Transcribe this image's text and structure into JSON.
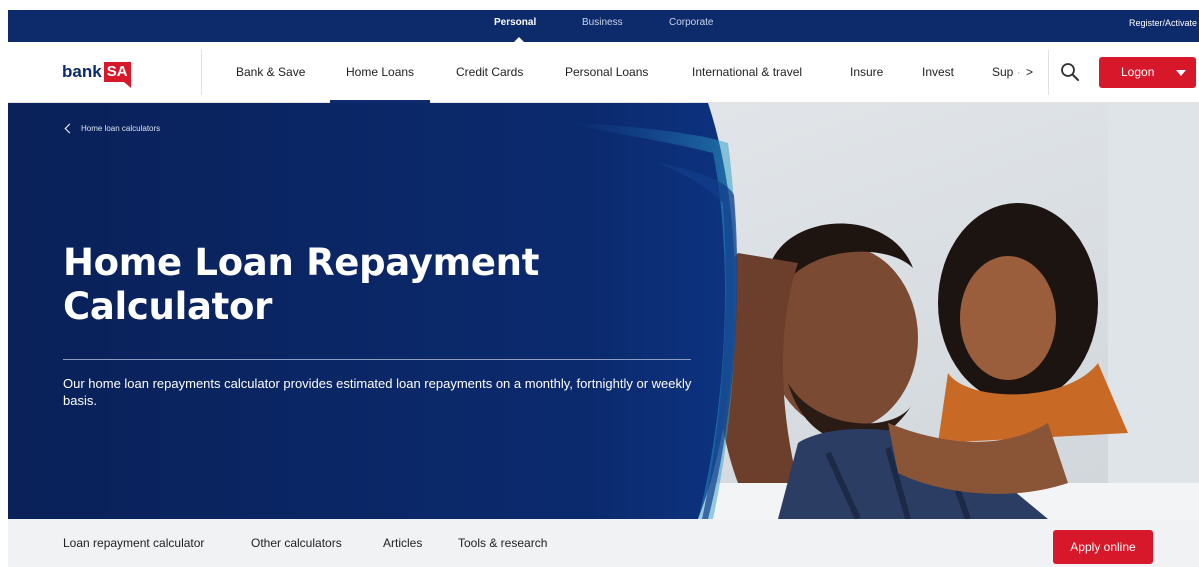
{
  "segments": {
    "items": [
      {
        "label": "Personal",
        "active": true
      },
      {
        "label": "Business",
        "active": false
      },
      {
        "label": "Corporate",
        "active": false
      }
    ],
    "register_label": "Register/Activate"
  },
  "brand": {
    "logo_text": "bank",
    "logo_badge": "SA",
    "accent": "#d6182a",
    "navy": "#0d2a6b"
  },
  "nav": {
    "items": [
      {
        "label": "Bank & Save"
      },
      {
        "label": "Home Loans",
        "active": true
      },
      {
        "label": "Credit Cards"
      },
      {
        "label": "Personal Loans"
      },
      {
        "label": "International & travel"
      },
      {
        "label": "Insure"
      },
      {
        "label": "Invest"
      }
    ],
    "truncated_label": "Sup",
    "more_glyph": ">",
    "search_icon": "search-icon",
    "logon_label": "Logon"
  },
  "hero": {
    "breadcrumb": "Home loan calculators",
    "title": "Home Loan Repayment Calculator",
    "description": "Our home loan repayments calculator provides estimated loan repayments on a monthly, fortnightly or weekly basis."
  },
  "subnav": {
    "items": [
      {
        "label": "Loan repayment calculator"
      },
      {
        "label": "Other calculators"
      },
      {
        "label": "Articles"
      },
      {
        "label": "Tools & research"
      }
    ],
    "apply_label": "Apply online"
  }
}
